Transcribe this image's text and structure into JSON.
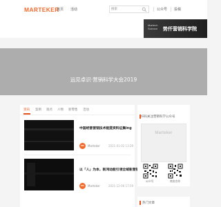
{
  "header": {
    "logo": "MARTEKER",
    "nav": [
      "首页",
      "活动"
    ],
    "search_placeholder": "搜索",
    "right_links": [
      "公众号",
      "投稿"
    ]
  },
  "banner": {
    "small_text": "Martech Science",
    "big_text": "势仟营销科学院"
  },
  "hero": {
    "title": "远见卓识·营销科学大会2019"
  },
  "main": {
    "tabs": [
      "资讯",
      "案例",
      "观点",
      "人物",
      "新零售",
      "活动"
    ],
    "active_tab": 0,
    "articles": [
      {
        "title": "中国经营营销技术能提资料征集ing",
        "author": "Marteker",
        "date": "2021-01-02 13:29",
        "avatar": "MK"
      },
      {
        "title": "以「人」为本，新鸿动能引领全域新营销新范式",
        "author": "Marteker",
        "date": "2021-12-06 17:59",
        "avatar": "MK"
      }
    ]
  },
  "sidebar": {
    "follow_title": "扫码关注营销科学公众号",
    "cover_text": "Marteker",
    "qr_labels": [
      "公众号",
      "商务合作"
    ],
    "hot_title": "热门文章"
  },
  "colors": {
    "accent": "#e8541e",
    "logo": "#f26b2d",
    "hero_bg": "#adadad"
  }
}
